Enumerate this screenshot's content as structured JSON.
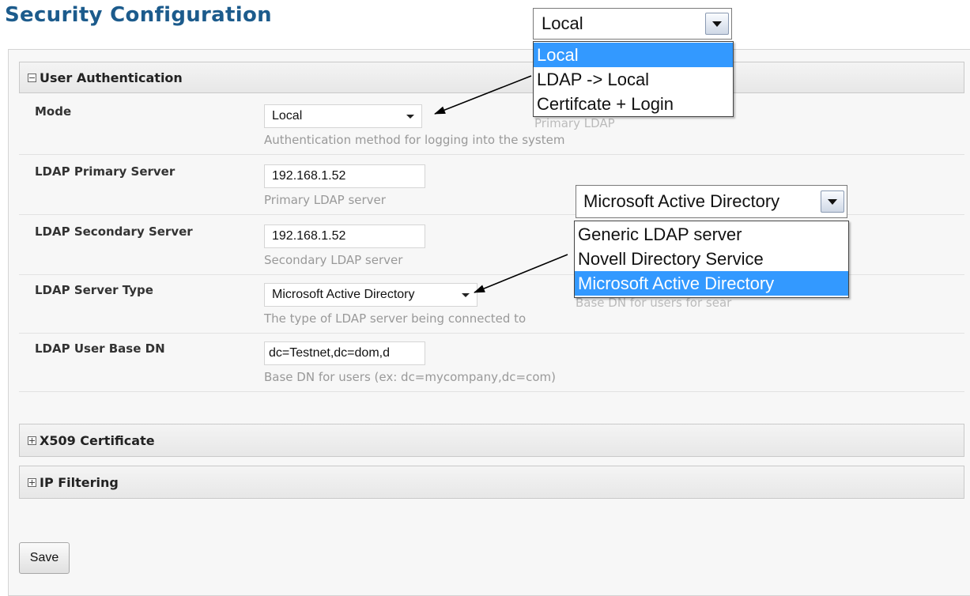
{
  "page": {
    "title": "Security Configuration"
  },
  "sections": {
    "user_auth": {
      "title": "User Authentication",
      "expanded": true
    },
    "x509": {
      "title": "X509 Certificate",
      "expanded": false
    },
    "ip_filtering": {
      "title": "IP Filtering",
      "expanded": false
    }
  },
  "fields": {
    "mode": {
      "label": "Mode",
      "value": "Local",
      "help": "Authentication method for logging into the system"
    },
    "ldap_primary": {
      "label": "LDAP Primary Server",
      "value": "192.168.1.52",
      "help": "Primary LDAP server"
    },
    "ldap_secondary": {
      "label": "LDAP Secondary Server",
      "value": "192.168.1.52",
      "help": "Secondary LDAP server"
    },
    "ldap_type": {
      "label": "LDAP Server Type",
      "value": "Microsoft Active Directory",
      "help": "The type of LDAP server being connected to"
    },
    "ldap_base_dn": {
      "label": "LDAP User Base DN",
      "value": "dc=Testnet,dc=dom,d",
      "help": "Base DN for users (ex: dc=mycompany,dc=com)"
    }
  },
  "save_label": "Save",
  "mode_dropdown": {
    "selected": "Local",
    "options": [
      "Local",
      "LDAP -> Local",
      "Certifcate + Login"
    ],
    "highlighted": "Local"
  },
  "ldap_type_dropdown": {
    "selected": "Microsoft Active Directory",
    "options": [
      "Generic LDAP server",
      "Novell Directory Service",
      "Microsoft Active Directory"
    ],
    "highlighted": "Microsoft Active Directory"
  },
  "colors": {
    "title": "#1c5b8c",
    "highlight": "#3399ff",
    "help_text": "#999999"
  }
}
